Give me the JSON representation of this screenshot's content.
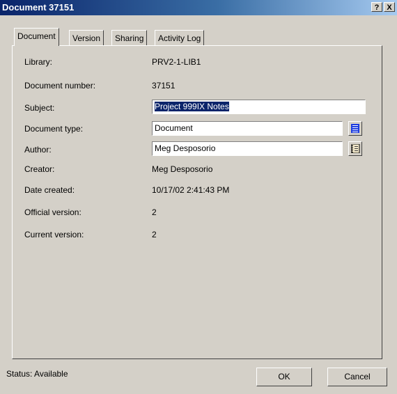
{
  "window": {
    "title": "Document 37151",
    "help_label": "?",
    "close_label": "X"
  },
  "tabs": [
    {
      "label": "Document",
      "active": true
    },
    {
      "label": "Version",
      "active": false
    },
    {
      "label": "Sharing",
      "active": false
    },
    {
      "label": "Activity Log",
      "active": false
    }
  ],
  "fields": {
    "library": {
      "label": "Library:",
      "value": "PRV2-1-LIB1"
    },
    "document_number": {
      "label": "Document number:",
      "value": "37151"
    },
    "subject": {
      "label": "Subject:",
      "value": "Project 999IX Notes"
    },
    "document_type": {
      "label": "Document type:",
      "value": "Document",
      "button_icon": "list-icon"
    },
    "author": {
      "label": "Author:",
      "value": "Meg Desposorio",
      "button_icon": "address-book-icon"
    },
    "creator": {
      "label": "Creator:",
      "value": "Meg Desposorio"
    },
    "date_created": {
      "label": "Date created:",
      "value": "10/17/02 2:41:43 PM"
    },
    "official_version": {
      "label": "Official version:",
      "value": "2"
    },
    "current_version": {
      "label": "Current version:",
      "value": "2"
    }
  },
  "footer": {
    "status": "Status: Available",
    "ok_label": "OK",
    "cancel_label": "Cancel"
  },
  "colors": {
    "titlebar_start": "#0a246a",
    "titlebar_end": "#a6caf0",
    "dialog_face": "#d4d0c8",
    "selection": "#0a246a"
  }
}
